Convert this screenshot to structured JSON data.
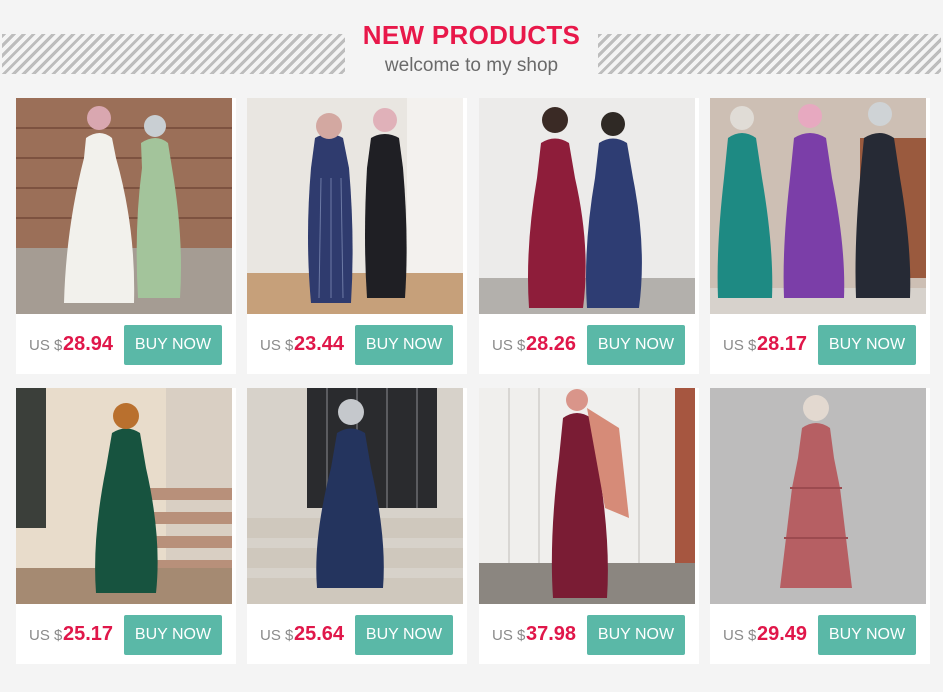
{
  "header": {
    "title": "NEW PRODUCTS",
    "subtitle": "welcome to my shop"
  },
  "colors": {
    "title": "#e8184a",
    "price": "#e0174a",
    "button": "#5ab8a7"
  },
  "products": [
    {
      "currency": "US $",
      "price": "28.94",
      "button": "BUY NOW",
      "image": "white polka dot maxi dress and green dress"
    },
    {
      "currency": "US $",
      "price": "23.44",
      "button": "BUY NOW",
      "image": "navy and black striped abaya dresses"
    },
    {
      "currency": "US $",
      "price": "28.26",
      "button": "BUY NOW",
      "image": "burgundy and navy sequin dresses"
    },
    {
      "currency": "US $",
      "price": "28.17",
      "button": "BUY NOW",
      "image": "teal, purple and black ruffle dresses"
    },
    {
      "currency": "US $",
      "price": "25.17",
      "button": "BUY NOW",
      "image": "dark green pleated maxi dress"
    },
    {
      "currency": "US $",
      "price": "25.64",
      "button": "BUY NOW",
      "image": "navy polka dot ruffle dress"
    },
    {
      "currency": "US $",
      "price": "37.98",
      "button": "BUY NOW",
      "image": "burgundy sequin maxi dress"
    },
    {
      "currency": "US $",
      "price": "29.49",
      "button": "BUY NOW",
      "image": "dusty rose tiered dress"
    }
  ]
}
